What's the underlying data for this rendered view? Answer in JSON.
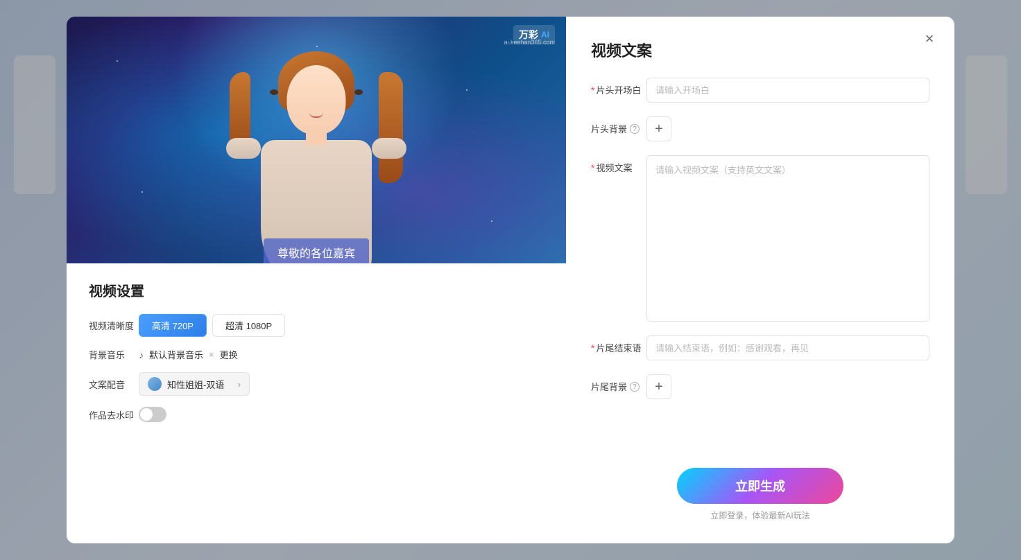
{
  "background": {
    "color": "#e8eef5"
  },
  "modal": {
    "close_button": "×"
  },
  "left_panel": {
    "video_preview": {
      "brand_name": "万彩",
      "brand_ai": "AI",
      "brand_url": "ai.keehan365.com",
      "subtitle": "尊敬的各位嘉宾"
    },
    "settings": {
      "title": "视频设置",
      "quality_label": "视频清晰度",
      "quality_options": [
        {
          "label": "高清 720P",
          "active": true
        },
        {
          "label": "超清 1080P",
          "active": false
        }
      ],
      "music_label": "背景音乐",
      "music_name": "默认背景音乐",
      "music_change": "更换",
      "voice_label": "文案配音",
      "voice_name": "知性姐姐-双语",
      "watermark_label": "作品去水印"
    }
  },
  "right_panel": {
    "title": "视频文案",
    "fields": {
      "opening_label": "片头开场白",
      "opening_required": "*",
      "opening_placeholder": "请输入开场白",
      "bg_head_label": "片头背景",
      "content_label": "视频文案",
      "content_required": "*",
      "content_placeholder": "请输入视频文案（支持英文文案）",
      "ending_label": "片尾结束语",
      "ending_required": "*",
      "ending_placeholder": "请输入结束语，例如：感谢观看，再见",
      "bg_tail_label": "片尾背景"
    },
    "generate_button": "立即生成",
    "generate_hint": "立即登录，体验最新AI玩法"
  }
}
